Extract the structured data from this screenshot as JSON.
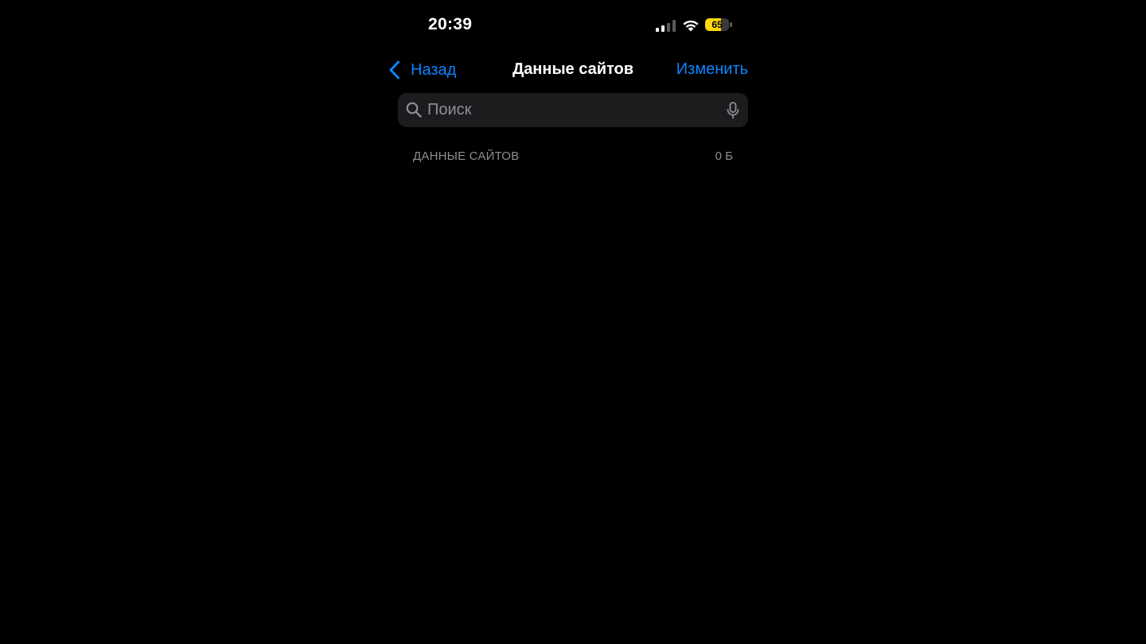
{
  "status_bar": {
    "time": "20:39",
    "battery_percent": "65",
    "battery_level": 0.65,
    "signal_bars_active": 2,
    "signal_bars_total": 4
  },
  "nav": {
    "back_label": "Назад",
    "title": "Данные сайтов",
    "edit_label": "Изменить"
  },
  "search": {
    "placeholder": "Поиск",
    "value": ""
  },
  "section": {
    "title": "ДАННЫЕ САЙТОВ",
    "size": "0 Б"
  },
  "colors": {
    "background": "#000000",
    "accent": "#0a84ff",
    "search_field": "#1c1c1e",
    "secondary_text": "#8e8e93",
    "battery": "#ffd60a"
  },
  "icons": {
    "back": "chevron-left-icon",
    "search": "magnifying-glass-icon",
    "mic": "microphone-icon",
    "wifi": "wifi-icon",
    "signal": "cellular-signal-icon",
    "battery": "battery-icon"
  }
}
